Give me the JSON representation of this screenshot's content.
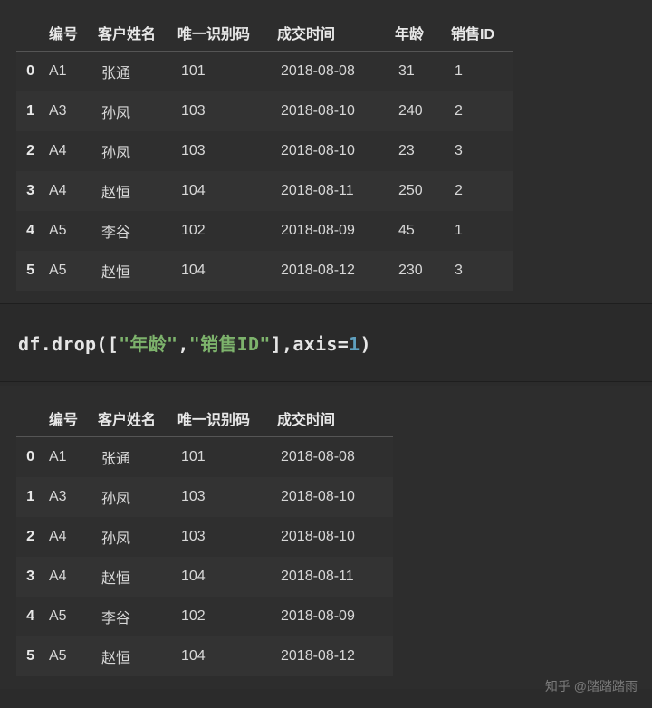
{
  "table1": {
    "headers": [
      "",
      "编号",
      "客户姓名",
      "唯一识别码",
      "成交时间",
      "年龄",
      "销售ID"
    ],
    "rows": [
      {
        "idx": "0",
        "cols": [
          "A1",
          "张通",
          "101",
          "2018-08-08",
          "31",
          "1"
        ]
      },
      {
        "idx": "1",
        "cols": [
          "A3",
          "孙凤",
          "103",
          "2018-08-10",
          "240",
          "2"
        ]
      },
      {
        "idx": "2",
        "cols": [
          "A4",
          "孙凤",
          "103",
          "2018-08-10",
          "23",
          "3"
        ]
      },
      {
        "idx": "3",
        "cols": [
          "A4",
          "赵恒",
          "104",
          "2018-08-11",
          "250",
          "2"
        ]
      },
      {
        "idx": "4",
        "cols": [
          "A5",
          "李谷",
          "102",
          "2018-08-09",
          "45",
          "1"
        ]
      },
      {
        "idx": "5",
        "cols": [
          "A5",
          "赵恒",
          "104",
          "2018-08-12",
          "230",
          "3"
        ]
      }
    ]
  },
  "code": {
    "obj": "df",
    "dot": ".",
    "method": "drop",
    "lparen": "(",
    "lbrack": "[",
    "str1": "\"年龄\"",
    "comma1": ",",
    "str2": "\"销售ID\"",
    "rbrack": "]",
    "comma2": ",",
    "axis_kw": "axis",
    "eq": "=",
    "axis_val": "1",
    "rparen": ")"
  },
  "table2": {
    "headers": [
      "",
      "编号",
      "客户姓名",
      "唯一识别码",
      "成交时间"
    ],
    "rows": [
      {
        "idx": "0",
        "cols": [
          "A1",
          "张通",
          "101",
          "2018-08-08"
        ]
      },
      {
        "idx": "1",
        "cols": [
          "A3",
          "孙凤",
          "103",
          "2018-08-10"
        ]
      },
      {
        "idx": "2",
        "cols": [
          "A4",
          "孙凤",
          "103",
          "2018-08-10"
        ]
      },
      {
        "idx": "3",
        "cols": [
          "A4",
          "赵恒",
          "104",
          "2018-08-11"
        ]
      },
      {
        "idx": "4",
        "cols": [
          "A5",
          "李谷",
          "102",
          "2018-08-09"
        ]
      },
      {
        "idx": "5",
        "cols": [
          "A5",
          "赵恒",
          "104",
          "2018-08-12"
        ]
      }
    ]
  },
  "watermark": "知乎 @踏踏踏雨"
}
